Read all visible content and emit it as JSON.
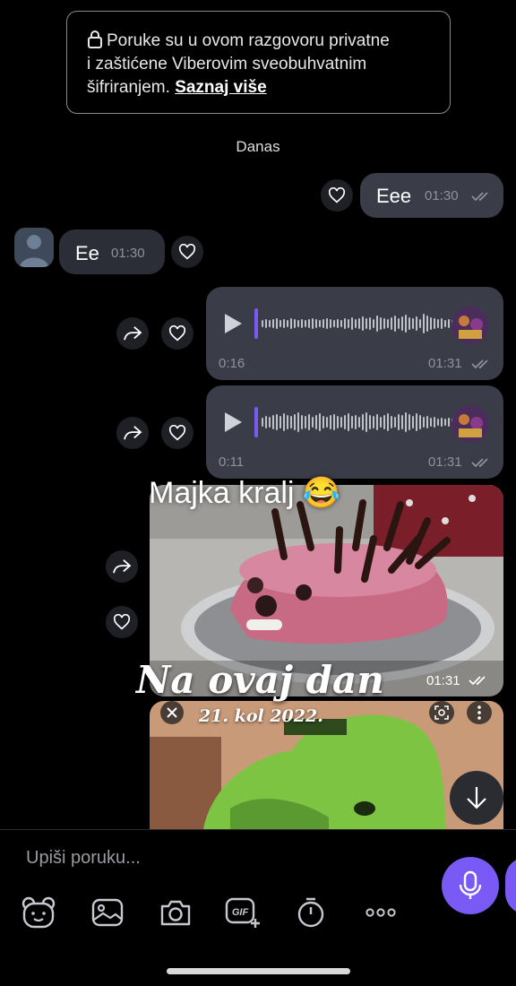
{
  "encryption_notice": {
    "line1": "Poruke su u ovom razgovoru privatne",
    "line2": "i zaštićene Viberovim sveobuhvatnim",
    "line3_prefix": "šifriranjem. ",
    "link": "Saznaj više"
  },
  "date_separator": "Danas",
  "messages": [
    {
      "direction": "outgoing",
      "text": "Eee",
      "time": "01:30"
    },
    {
      "direction": "incoming",
      "text": "Ee",
      "time": "01:30"
    },
    {
      "direction": "outgoing",
      "type": "voice",
      "duration": "0:16",
      "time": "01:31"
    },
    {
      "direction": "outgoing",
      "type": "voice",
      "duration": "0:11",
      "time": "01:31"
    },
    {
      "direction": "outgoing",
      "type": "image",
      "time": "01:31"
    }
  ],
  "overlay": {
    "caption": "Majka kralj 😂",
    "sticker_title": "Na ovaj dan",
    "sticker_date": "21. kol 2022."
  },
  "composer": {
    "placeholder": "Upiši poruku..."
  },
  "toolbar_icons": [
    "sticker-icon",
    "gallery-icon",
    "camera-icon",
    "gif-icon",
    "timer-icon",
    "more-icon"
  ],
  "colors": {
    "accent": "#7a5af5",
    "bubble": "#3a3d48",
    "background": "#000000"
  }
}
